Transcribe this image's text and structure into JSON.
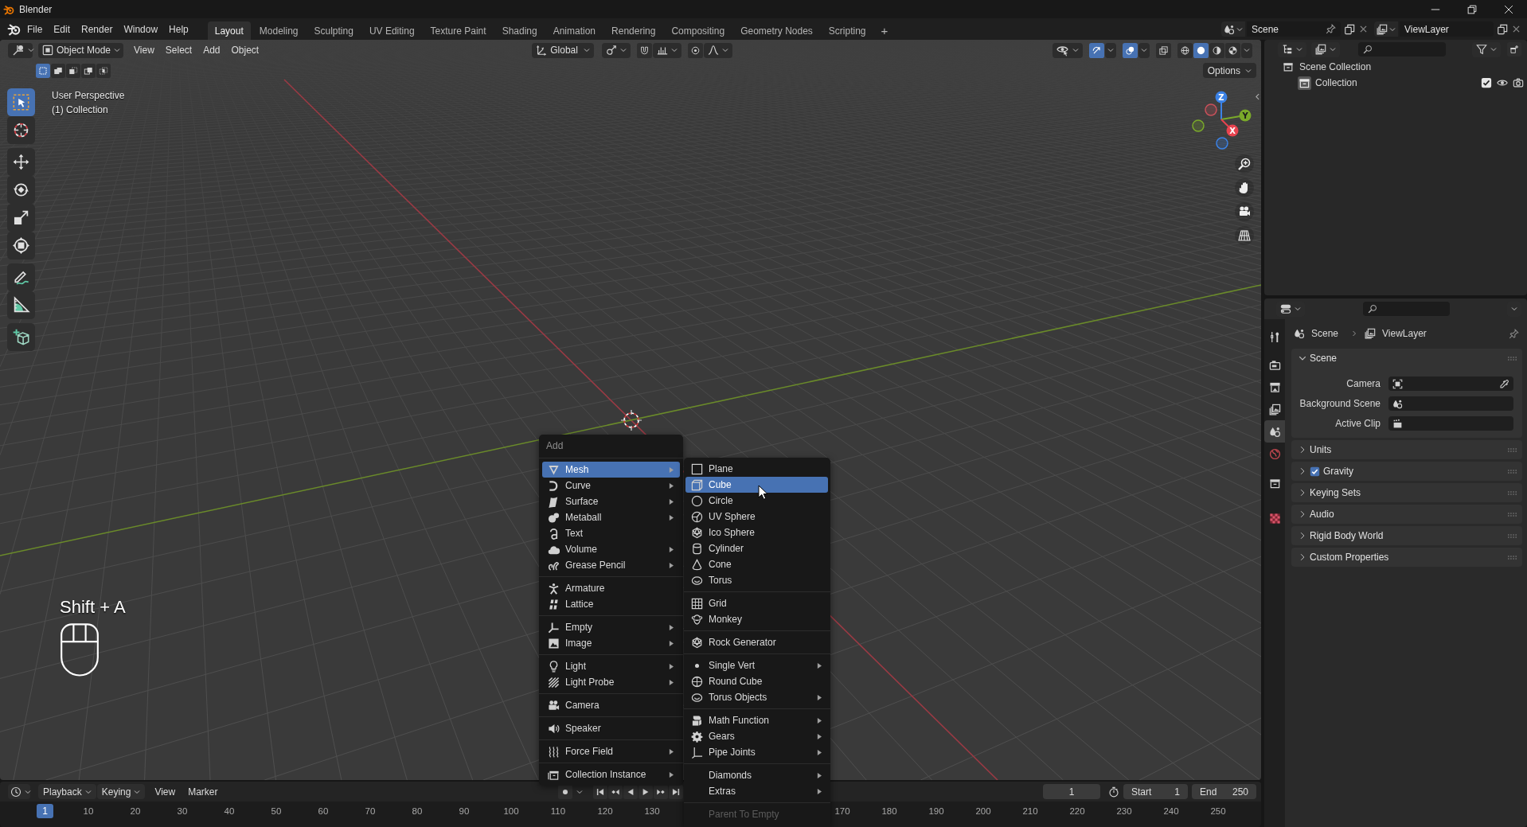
{
  "title_bar": {
    "title": "Blender"
  },
  "menu_bar": {
    "menus": [
      "File",
      "Edit",
      "Render",
      "Window",
      "Help"
    ],
    "workspace_tabs": [
      {
        "label": "Layout",
        "selected": true
      },
      {
        "label": "Modeling",
        "selected": false
      },
      {
        "label": "Sculpting",
        "selected": false
      },
      {
        "label": "UV Editing",
        "selected": false
      },
      {
        "label": "Texture Paint",
        "selected": false
      },
      {
        "label": "Shading",
        "selected": false
      },
      {
        "label": "Animation",
        "selected": false
      },
      {
        "label": "Rendering",
        "selected": false
      },
      {
        "label": "Compositing",
        "selected": false
      },
      {
        "label": "Geometry Nodes",
        "selected": false
      },
      {
        "label": "Scripting",
        "selected": false
      }
    ],
    "add_tab": "+"
  },
  "scene_selector": {
    "value": "Scene"
  },
  "view_layer_selector": {
    "value": "ViewLayer"
  },
  "viewport": {
    "header": {
      "mode": "Object Mode",
      "menus": [
        "View",
        "Select",
        "Add",
        "Object"
      ],
      "orientation": "Global",
      "snap": {
        "on": false
      },
      "proportional_editing": {
        "on": false
      },
      "gizmos": {
        "on": true
      },
      "overlays": {
        "on": true
      },
      "xray": {
        "on": false
      },
      "shading_modes": [
        {
          "selected": false
        },
        {
          "selected": true
        },
        {
          "selected": false
        },
        {
          "selected": false
        }
      ]
    },
    "select_modes": [
      {
        "selected": true
      },
      {
        "selected": false
      },
      {
        "selected": false
      },
      {
        "selected": false
      },
      {
        "selected": false
      }
    ],
    "options": "Options",
    "view_name": "User Perspective",
    "collection_info": "(1) Collection",
    "tools": [
      {
        "selected": true
      },
      {
        "selected": false
      },
      {
        "selected": false
      },
      {
        "selected": false
      },
      {
        "selected": false
      },
      {
        "selected": false
      },
      {
        "selected": false
      },
      {
        "selected": false
      },
      {
        "selected": false
      }
    ],
    "gizmo_axes": [
      "Z",
      "Y",
      "X"
    ],
    "shortcut": "Shift + A"
  },
  "add_menu": {
    "title": "Add",
    "groups": [
      {
        "items": [
          {
            "label": "Mesh",
            "submenu": true,
            "selected": true
          },
          {
            "label": "Curve",
            "submenu": true,
            "selected": false
          },
          {
            "label": "Surface",
            "submenu": true,
            "selected": false
          },
          {
            "label": "Metaball",
            "submenu": true,
            "selected": false
          },
          {
            "label": "Text",
            "submenu": false,
            "selected": false
          },
          {
            "label": "Volume",
            "submenu": true,
            "selected": false
          },
          {
            "label": "Grease Pencil",
            "submenu": true,
            "selected": false
          }
        ]
      },
      {
        "items": [
          {
            "label": "Armature",
            "submenu": false,
            "selected": false
          },
          {
            "label": "Lattice",
            "submenu": false,
            "selected": false
          }
        ]
      },
      {
        "items": [
          {
            "label": "Empty",
            "submenu": true,
            "selected": false
          },
          {
            "label": "Image",
            "submenu": true,
            "selected": false
          }
        ]
      },
      {
        "items": [
          {
            "label": "Light",
            "submenu": true,
            "selected": false
          },
          {
            "label": "Light Probe",
            "submenu": true,
            "selected": false
          }
        ]
      },
      {
        "items": [
          {
            "label": "Camera",
            "submenu": false,
            "selected": false
          }
        ]
      },
      {
        "items": [
          {
            "label": "Speaker",
            "submenu": false,
            "selected": false
          }
        ]
      },
      {
        "items": [
          {
            "label": "Force Field",
            "submenu": true,
            "selected": false
          }
        ]
      },
      {
        "items": [
          {
            "label": "Collection Instance",
            "submenu": true,
            "selected": false
          }
        ]
      }
    ]
  },
  "mesh_submenu": {
    "groups": [
      {
        "items": [
          {
            "label": "Plane",
            "submenu": false,
            "selected": false,
            "disabled": false
          },
          {
            "label": "Cube",
            "submenu": false,
            "selected": true,
            "disabled": false
          },
          {
            "label": "Circle",
            "submenu": false,
            "selected": false,
            "disabled": false
          },
          {
            "label": "UV Sphere",
            "submenu": false,
            "selected": false,
            "disabled": false
          },
          {
            "label": "Ico Sphere",
            "submenu": false,
            "selected": false,
            "disabled": false
          },
          {
            "label": "Cylinder",
            "submenu": false,
            "selected": false,
            "disabled": false
          },
          {
            "label": "Cone",
            "submenu": false,
            "selected": false,
            "disabled": false
          },
          {
            "label": "Torus",
            "submenu": false,
            "selected": false,
            "disabled": false
          }
        ]
      },
      {
        "items": [
          {
            "label": "Grid",
            "submenu": false,
            "selected": false,
            "disabled": false
          },
          {
            "label": "Monkey",
            "submenu": false,
            "selected": false,
            "disabled": false
          }
        ]
      },
      {
        "items": [
          {
            "label": "Rock Generator",
            "submenu": false,
            "selected": false,
            "disabled": false
          }
        ]
      },
      {
        "items": [
          {
            "label": "Single Vert",
            "submenu": true,
            "selected": false,
            "disabled": false
          },
          {
            "label": "Round Cube",
            "submenu": false,
            "selected": false,
            "disabled": false
          },
          {
            "label": "Torus Objects",
            "submenu": true,
            "selected": false,
            "disabled": false
          }
        ]
      },
      {
        "items": [
          {
            "label": "Math Function",
            "submenu": true,
            "selected": false,
            "disabled": false
          },
          {
            "label": "Gears",
            "submenu": true,
            "selected": false,
            "disabled": false
          },
          {
            "label": "Pipe Joints",
            "submenu": true,
            "selected": false,
            "disabled": false
          }
        ]
      },
      {
        "items": [
          {
            "label": "Diamonds",
            "submenu": true,
            "selected": false,
            "disabled": false
          },
          {
            "label": "Extras",
            "submenu": true,
            "selected": false,
            "disabled": false
          }
        ]
      },
      {
        "items": [
          {
            "label": "Parent To Empty",
            "submenu": false,
            "selected": false,
            "disabled": true
          }
        ]
      }
    ]
  },
  "outliner": {
    "tree": [
      {
        "label": "Scene Collection",
        "children": [
          {
            "label": "Collection",
            "checked": true
          }
        ]
      }
    ]
  },
  "properties": {
    "tabs": [
      {
        "selected": false
      },
      {
        "selected": false
      },
      {
        "selected": false
      },
      {
        "selected": false
      },
      {
        "selected": true
      },
      {
        "selected": false
      },
      {
        "selected": false
      },
      {
        "selected": false
      }
    ],
    "breadcrumb": [
      "Scene",
      "ViewLayer"
    ],
    "panels": [
      {
        "title": "Scene",
        "expanded": true,
        "fields": [
          {
            "label": "Camera"
          },
          {
            "label": "Background Scene"
          },
          {
            "label": "Active Clip"
          }
        ]
      },
      {
        "title": "Units",
        "expanded": false
      },
      {
        "title": "Gravity",
        "expanded": false,
        "checkbox": {
          "checked": true
        }
      },
      {
        "title": "Keying Sets",
        "expanded": false
      },
      {
        "title": "Audio",
        "expanded": false
      },
      {
        "title": "Rigid Body World",
        "expanded": false
      },
      {
        "title": "Custom Properties",
        "expanded": false
      }
    ]
  },
  "timeline": {
    "menus": [
      {
        "label": "Playback",
        "dropdown": true
      },
      {
        "label": "Keying",
        "dropdown": true
      },
      {
        "label": "View",
        "dropdown": false
      },
      {
        "label": "Marker",
        "dropdown": false
      }
    ],
    "current_frame": "1",
    "start": {
      "label": "Start",
      "value": "1"
    },
    "end": {
      "label": "End",
      "value": "250"
    },
    "ruler": {
      "playhead": "1",
      "labels_before": [
        "10",
        "20",
        "30",
        "40",
        "50",
        "60",
        "70",
        "80",
        "90",
        "100",
        "110",
        "120",
        "130"
      ],
      "labels_after": [
        "170",
        "180",
        "190",
        "200",
        "210",
        "220",
        "230",
        "240",
        "250"
      ]
    }
  }
}
